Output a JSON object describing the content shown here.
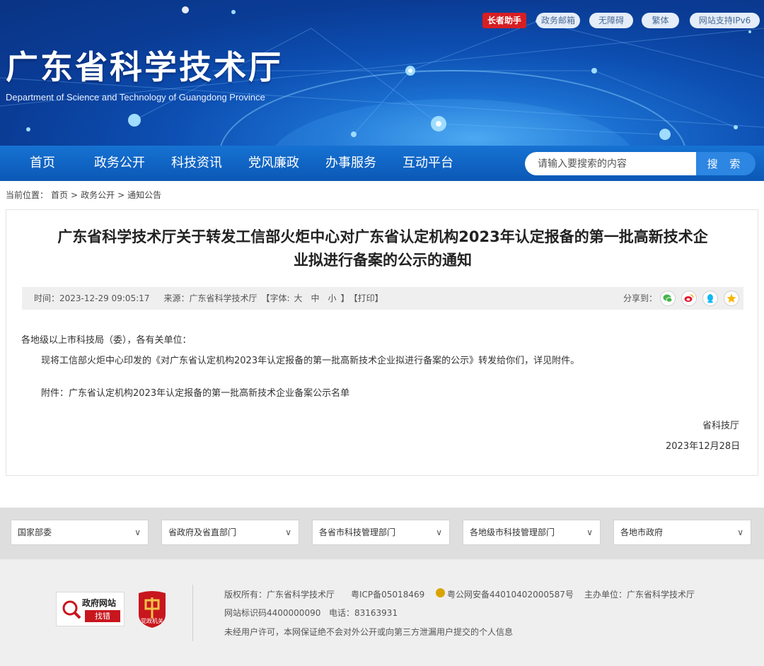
{
  "header": {
    "title": "广东省科学技术厅",
    "subtitle": "Department of Science and Technology of Guangdong Province",
    "top_links": [
      "长者助手",
      "政务邮箱",
      "无障碍",
      "繁体",
      "网站支持IPv6"
    ]
  },
  "nav": {
    "items": [
      "首页",
      "政务公开",
      "科技资讯",
      "党风廉政",
      "办事服务",
      "互动平台"
    ],
    "search_placeholder": "请输入要搜索的内容",
    "search_button": "搜 索"
  },
  "breadcrumb": [
    "当前位置：",
    "首页",
    ">",
    "政务公开",
    ">",
    "通知公告"
  ],
  "article": {
    "title_line1": "广东省科学技术厅关于转发工信部火炬中心对广东省认定机构2023年认定报备的第一批高新技术企",
    "title_line2": "业拟进行备案的公示的通知",
    "meta": {
      "time": "时间：2023-12-29 09:05:17",
      "source": "来源：广东省科学技术厅",
      "font_label": "【字体:",
      "font_large": "大",
      "font_medium": "中",
      "font_small": "小",
      "font_close": "】",
      "print": "【打印】",
      "share_label": "分享到："
    },
    "salutation": "各地级以上市科技局（委），各有关单位：",
    "paragraph": "现将工信部火炬中心印发的《对广东省认定机构2023年认定报备的第一批高新技术企业拟进行备案的公示》转发给你们，详见附件。",
    "attachment": "附件：广东省认定机构2023年认定报备的第一批高新技术企业备案公示名单",
    "signature": "省科技厅",
    "date": "2023年12月28日"
  },
  "footer_links": [
    "国家部委",
    "省政府及省直部门",
    "各省市科技管理部门",
    "各地级市科技管理部门",
    "各地市政府"
  ],
  "footer": {
    "badge1_line1": "政府网站",
    "badge1_line2": "找错",
    "badge2_text": "党政机关",
    "copyright": "版权所有：广东省科学技术厅",
    "icp": "粤ICP备05018469",
    "police": "粤公网安备44010402000587号",
    "sponsor": "主办单位：广东省科学技术厅",
    "site_id": "网站标识码4400000090",
    "phone": "电话：83163931",
    "notice": "未经用户许可，本网保证绝不会对外公开或向第三方泄漏用户提交的个人信息"
  },
  "colors": {
    "header_blue": "#0d4fb2",
    "nav_blue": "#1168c8",
    "accent_red": "#d71e23"
  }
}
